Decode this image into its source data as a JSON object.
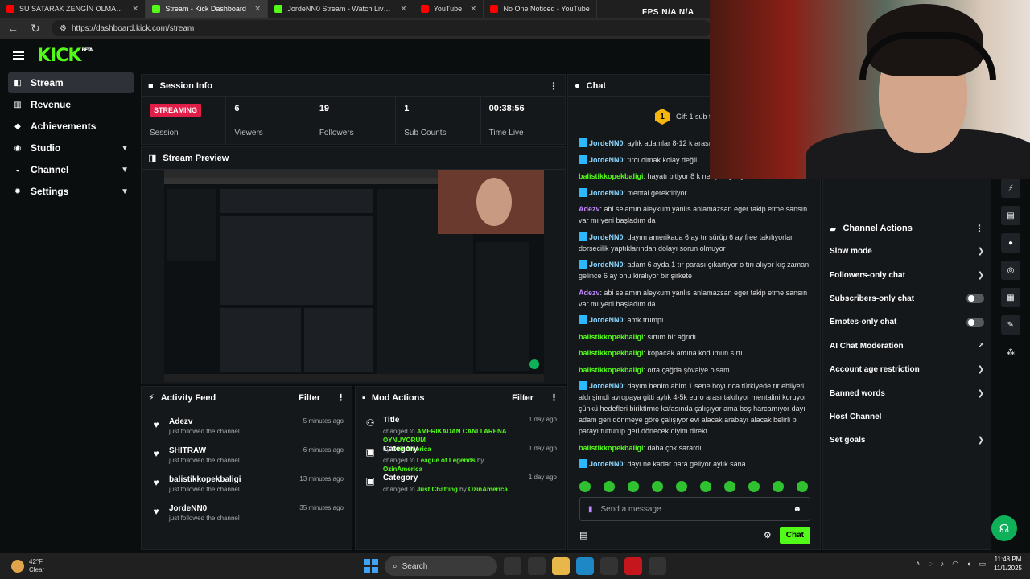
{
  "browser": {
    "tabs": [
      {
        "label": "SU SATARAK ZENGİN OLMAK! | K",
        "icon": "youtube-icon",
        "active": false
      },
      {
        "label": "Stream - Kick Dashboard",
        "icon": "kick-icon",
        "active": true
      },
      {
        "label": "JordeNN0 Stream - Watch Live o",
        "icon": "kick-icon",
        "active": false
      },
      {
        "label": "YouTube",
        "icon": "youtube-icon",
        "active": false
      },
      {
        "label": "No One Noticed - YouTube",
        "icon": "youtube-icon",
        "active": false
      }
    ],
    "url": "https://dashboard.kick.com/stream",
    "overlay": "FPS N/A N/A"
  },
  "brand": {
    "logo": "KICK",
    "beta": "BETA",
    "accent": "#53fc18"
  },
  "sidebar": {
    "items": [
      {
        "label": "Stream",
        "icon": "stream-icon",
        "active": true,
        "expand": false
      },
      {
        "label": "Revenue",
        "icon": "revenue-icon",
        "active": false,
        "expand": false
      },
      {
        "label": "Achievements",
        "icon": "achievements-icon",
        "active": false,
        "expand": false
      },
      {
        "label": "Studio",
        "icon": "studio-icon",
        "active": false,
        "expand": true
      },
      {
        "label": "Channel",
        "icon": "channel-icon",
        "active": false,
        "expand": true
      },
      {
        "label": "Settings",
        "icon": "settings-icon",
        "active": false,
        "expand": true
      }
    ]
  },
  "session_info": {
    "title": "Session Info",
    "stats": [
      {
        "value": "STREAMING",
        "label": "Session",
        "badge": true
      },
      {
        "value": "6",
        "label": "Viewers"
      },
      {
        "value": "19",
        "label": "Followers"
      },
      {
        "value": "1",
        "label": "Sub Counts"
      },
      {
        "value": "00:38:56",
        "label": "Time Live"
      }
    ]
  },
  "stream_preview": {
    "title": "Stream Preview"
  },
  "activity_feed": {
    "title": "Activity Feed",
    "filter_label": "Filter",
    "items": [
      {
        "name": "Adezv",
        "desc": "just followed the channel",
        "time": "5 minutes ago"
      },
      {
        "name": "SHITRAW",
        "desc": "just followed the channel",
        "time": "6 minutes ago"
      },
      {
        "name": "balistikkopekbaligi",
        "desc": "just followed the channel",
        "time": "13 minutes ago"
      },
      {
        "name": "JordeNN0",
        "desc": "just followed the channel",
        "time": "35 minutes ago"
      }
    ]
  },
  "mod_actions": {
    "title": "Mod Actions",
    "filter_label": "Filter",
    "items": [
      {
        "title": "Title",
        "time": "1 day ago",
        "prefix": "changed to",
        "value": "AMERIKADAN CANLI ARENA OYNUYORUM",
        "by_label": "by",
        "by": "OzinAmerica"
      },
      {
        "title": "Category",
        "time": "1 day ago",
        "prefix": "changed to",
        "value": "League of Legends",
        "by_label": "by",
        "by": "OzinAmerica"
      },
      {
        "title": "Category",
        "time": "1 day ago",
        "prefix": "changed to",
        "value": "Just Chatting",
        "by_label": "by",
        "by": "OzinAmerica"
      }
    ]
  },
  "chat": {
    "title": "Chat",
    "gift_text": "Gift 1 sub to",
    "gift_count": "1",
    "messages": [
      {
        "user": "JordeNN0",
        "badge": true,
        "color": "#8ad6ff",
        "text": "aylık adamlar 8-12 k arası"
      },
      {
        "user": "JordeNN0",
        "badge": true,
        "color": "#8ad6ff",
        "text": "tırcı olmak kolay değil"
      },
      {
        "user": "balistikkopekbaligi",
        "badge": false,
        "color": "#53fc18",
        "text": "hayatı bitiyor 8 k ne içine yüriyecek"
      },
      {
        "user": "JordeNN0",
        "badge": true,
        "color": "#8ad6ff",
        "text": "mental gerektiriyor"
      },
      {
        "user": "Adezv",
        "badge": false,
        "color": "#c084fc",
        "text": "abi selamın aleykum yanlıs anlamazsan eger takip etme sansın var mı yeni başladım da"
      },
      {
        "user": "JordeNN0",
        "badge": true,
        "color": "#8ad6ff",
        "text": "dayım amerikada 6 ay tır sürüp 6 ay free takılıyorlar dorsecilik yaptıklarından dolayı sorun olmuyor"
      },
      {
        "user": "JordeNN0",
        "badge": true,
        "color": "#8ad6ff",
        "text": "adam 6 ayda 1 tır parası çıkartıyor o tırı alıyor kış zamanı gelince 6 ay onu kiralıyor bir şirkete"
      },
      {
        "user": "Adezv",
        "badge": false,
        "color": "#c084fc",
        "text": "abi selamın aleykum yanlıs anlamazsan eger takip etme sansın var mı yeni başladım da"
      },
      {
        "user": "JordeNN0",
        "badge": true,
        "color": "#8ad6ff",
        "text": "amk trumpı"
      },
      {
        "user": "balistikkopekbaligi",
        "badge": false,
        "color": "#53fc18",
        "text": "sırtım bir ağrıdı"
      },
      {
        "user": "balistikkopekbaligi",
        "badge": false,
        "color": "#53fc18",
        "text": "kopacak amına kodumun sırtı"
      },
      {
        "user": "balistikkopekbaligi",
        "badge": false,
        "color": "#53fc18",
        "text": "orta çağda şövalye olsam"
      },
      {
        "user": "JordeNN0",
        "badge": true,
        "color": "#8ad6ff",
        "text": "dayım benim abim 1 sene boyunca türkiyede tır ehliyeti aldı şimdi avrupaya gitti aylık 4-5k euro arası takılıyor mentalini koruyor çünkü hedefleri biriktirme kafasında çalışıyor ama boş harcamıyor dayı adam geri dönmeye göre çalışıyor evi alacak arabayı alacak belirli bi parayı tutturup geri dönecek diyim direkt"
      },
      {
        "user": "balistikkopekbaligi",
        "badge": false,
        "color": "#53fc18",
        "text": "daha çok sarardı"
      },
      {
        "user": "JordeNN0",
        "badge": true,
        "color": "#8ad6ff",
        "text": "dayı ne kadar para geliyor aylık sana"
      }
    ],
    "input_placeholder": "Send a message",
    "send_label": "Chat"
  },
  "channel_actions": {
    "title": "Channel Actions",
    "items": [
      {
        "label": "Slow mode",
        "control": "chevron"
      },
      {
        "label": "Followers-only chat",
        "control": "chevron"
      },
      {
        "label": "Subscribers-only chat",
        "control": "toggle"
      },
      {
        "label": "Emotes-only chat",
        "control": "toggle"
      },
      {
        "label": "AI Chat Moderation",
        "control": "external"
      },
      {
        "label": "Account age restriction",
        "control": "chevron"
      },
      {
        "label": "Banned words",
        "control": "chevron"
      },
      {
        "label": "Host Channel",
        "control": "none"
      },
      {
        "label": "Set goals",
        "control": "chevron"
      }
    ]
  },
  "taskbar": {
    "weather_temp": "42°F",
    "weather_desc": "Clear",
    "search_label": "Search",
    "time": "11:48 PM",
    "date": "11/1/2025"
  }
}
